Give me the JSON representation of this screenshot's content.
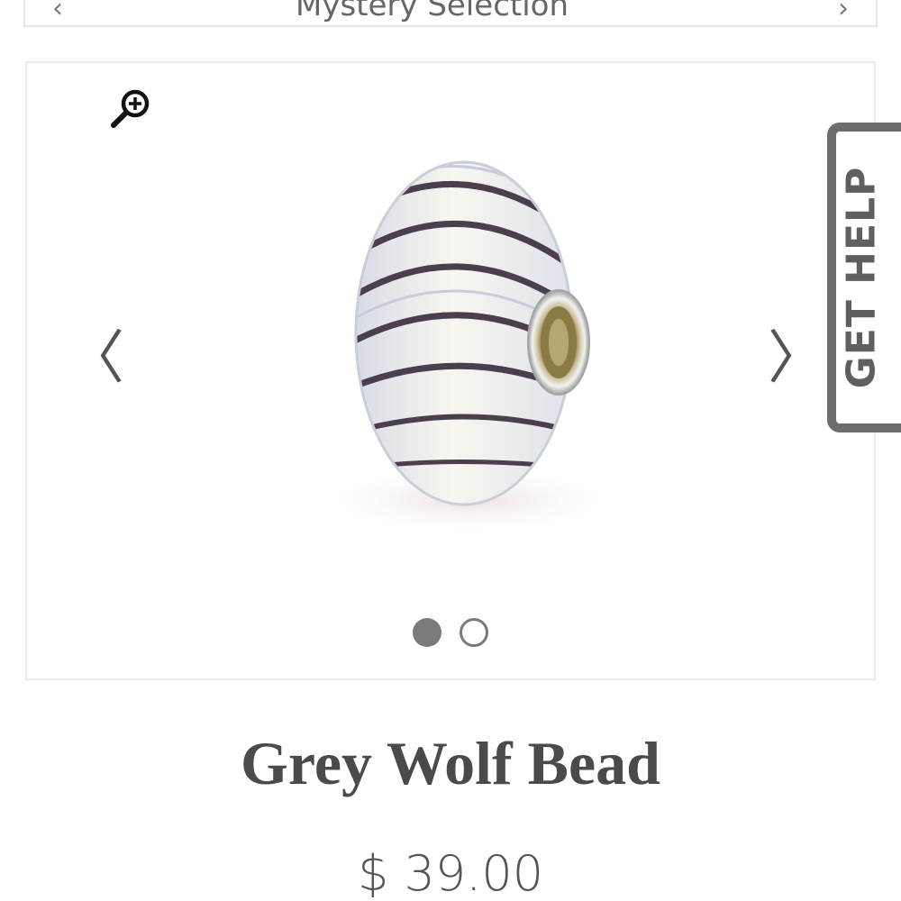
{
  "top_bar": {
    "prev_glyph": "‹",
    "next_glyph": "›",
    "cut_text": "Mystery Selection"
  },
  "gallery": {
    "zoom_icon": "zoom-in-icon",
    "prev_arrow": "〈",
    "next_arrow": "〉",
    "image_alt": "Grey Wolf Bead",
    "slides": 2,
    "active_slide": 1
  },
  "help_tab": {
    "label": "GET HELP"
  },
  "product": {
    "title": "Grey Wolf Bead",
    "price": "$ 39.00"
  },
  "colors": {
    "text": "#4a4a4a",
    "dot": "#7a7a7a",
    "help_border": "#6d6d6d"
  }
}
